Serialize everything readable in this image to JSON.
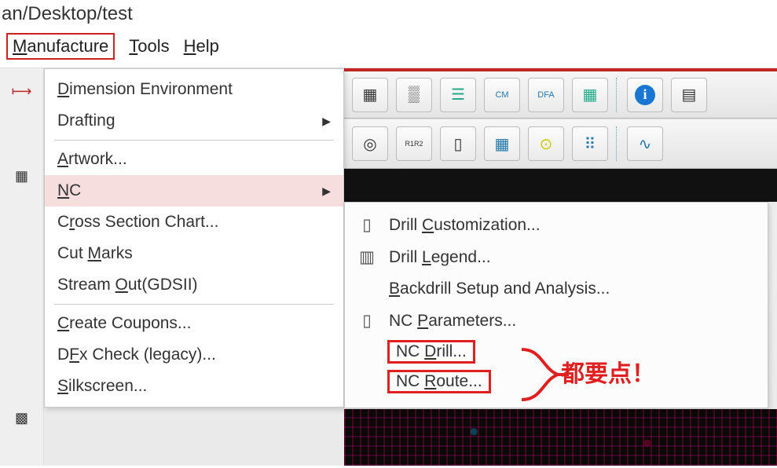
{
  "title_path": "an/Desktop/test",
  "menubar": {
    "manufacture": "Manufacture",
    "tools": "Tools",
    "help": "Help"
  },
  "menu": {
    "dimension": "Dimension Environment",
    "drafting": "Drafting",
    "artwork": "Artwork...",
    "nc": "NC",
    "cross_section": "Cross Section Chart...",
    "cut_marks": "Cut Marks",
    "stream_out": "Stream Out(GDSII)",
    "create_coupons": "Create Coupons...",
    "dfx_check": "DFx Check (legacy)...",
    "silkscreen": "Silkscreen..."
  },
  "submenu": {
    "drill_customization": "Drill Customization...",
    "drill_legend": "Drill Legend...",
    "backdrill": "Backdrill Setup and Analysis...",
    "nc_parameters": "NC Parameters...",
    "nc_drill": "NC Drill...",
    "nc_route": "NC Route..."
  },
  "callout_text": "都要点！"
}
